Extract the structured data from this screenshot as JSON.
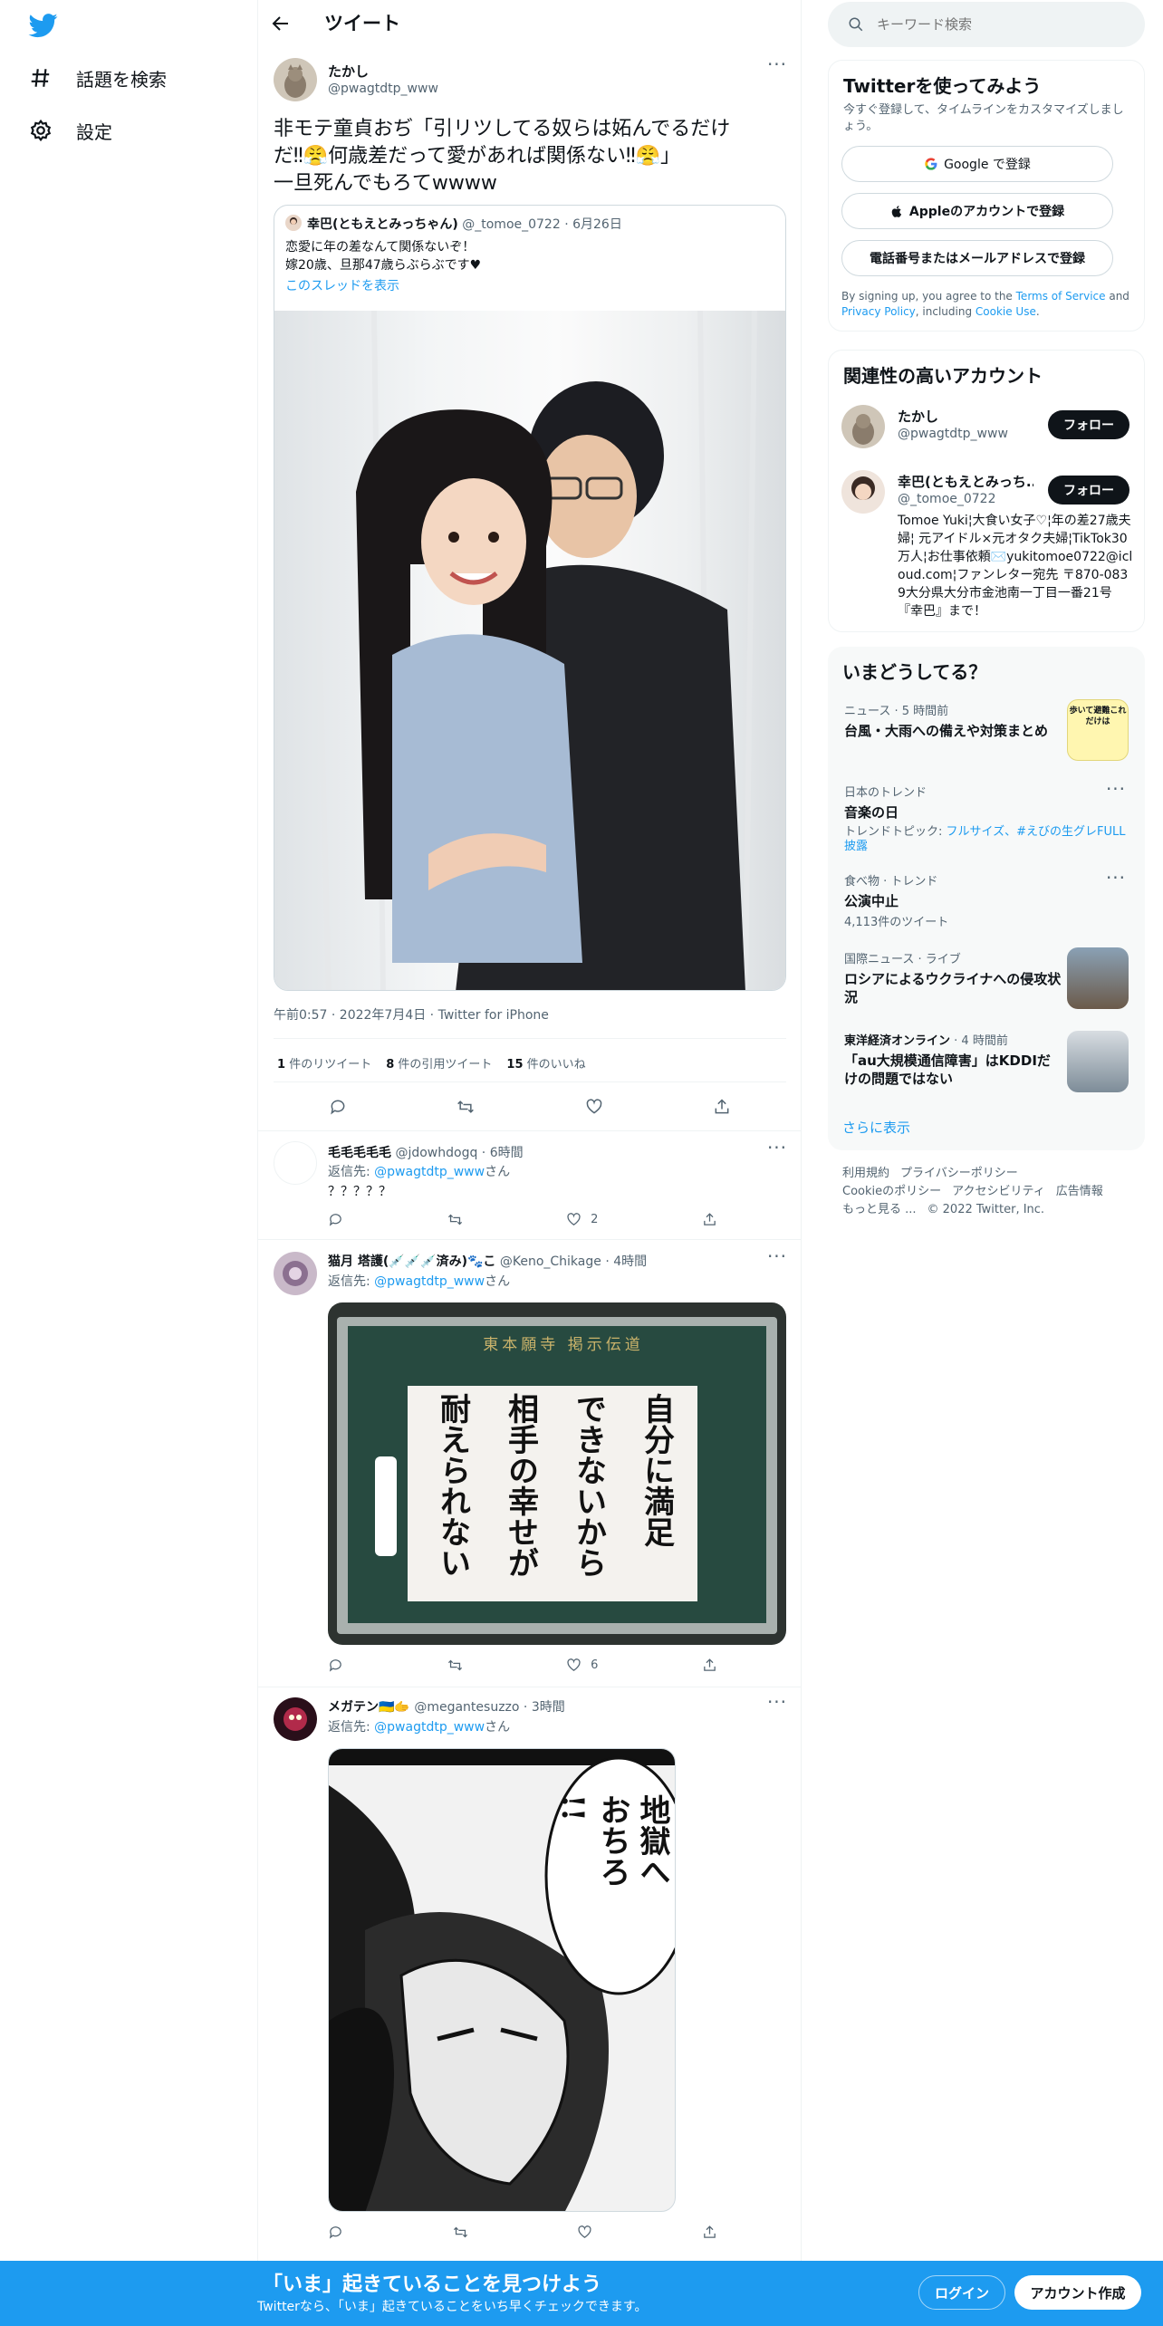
{
  "nav": {
    "explore": "話題を検索",
    "settings": "設定"
  },
  "header": {
    "title": "ツイート"
  },
  "tweet": {
    "name": "たかし",
    "handle": "@pwagtdtp_www",
    "text_line1": "非モテ童貞おぢ「引リツしてる奴らは妬んでるだけ",
    "text_line2": "だ‼😤何歳差だって愛があれば関係ない‼😤」",
    "text_line3": "一旦死んでもろてwwww",
    "quote": {
      "name": "幸巴(ともえとみっちゃん)",
      "handle": "@_tomoe_0722",
      "date": "6月26日",
      "line1": "恋愛に年の差なんて関係ないぞ！",
      "line2": "嫁20歳、旦那47歳らぶらぶです♥",
      "thread_link": "このスレッドを表示"
    },
    "timestamp": "午前0:57 · 2022年7月4日 · Twitter for iPhone",
    "retweets_count": "1",
    "retweets_label": "件のリツイート",
    "quotes_count": "8",
    "quotes_label": "件の引用ツイート",
    "likes_count": "15",
    "likes_label": "件のいいね"
  },
  "replies": [
    {
      "name": "毛毛毛毛毛",
      "handle": "@jdowhdogq",
      "time": "6時間",
      "reply_to_prefix": "返信先: ",
      "reply_to": "@pwagtdtp_www",
      "reply_to_suffix": "さん",
      "text": "？？？？？",
      "likes": "2"
    },
    {
      "name": "猫月 塔護(💉💉💉済み)🐾こ",
      "handle": "@Keno_Chikage",
      "time": "4時間",
      "reply_to_prefix": "返信先: ",
      "reply_to": "@pwagtdtp_www",
      "reply_to_suffix": "さん",
      "image_header": "東本願寺 掲示伝道",
      "image_text": [
        "自分に満足",
        "できないから",
        "相手の幸せが",
        "耐えられない"
      ],
      "likes": "6"
    },
    {
      "name": "メガテン🇺🇦🫱",
      "handle": "@megantesuzzo",
      "time": "3時間",
      "reply_to_prefix": "返信先: ",
      "reply_to": "@pwagtdtp_www",
      "reply_to_suffix": "さん",
      "image_text": [
        "地獄へ",
        "おちろ",
        "!!"
      ]
    }
  ],
  "search": {
    "placeholder": "キーワード検索"
  },
  "signup_panel": {
    "title": "Twitterを使ってみよう",
    "subtitle": "今すぐ登録して、タイムラインをカスタマイズしましょう。",
    "google": "Google で登録",
    "apple": "Appleのアカウントで登録",
    "phone": "電話番号またはメールアドレスで登録",
    "legal_1": "By signing up, you agree to the ",
    "tos": "Terms of Service",
    "legal_2": " and ",
    "privacy": "Privacy Policy",
    "legal_3": ", including ",
    "cookie": "Cookie Use",
    "legal_4": "."
  },
  "related": {
    "title": "関連性の高いアカウント",
    "follow": "フォロー",
    "accounts": [
      {
        "name": "たかし",
        "handle": "@pwagtdtp_www"
      },
      {
        "name": "幸巴(ともえとみっち...",
        "handle": "@_tomoe_0722",
        "bio": "Tomoe Yuki¦大食い女子♡¦年の差27歳夫婦¦ 元アイドル×元オタク夫婦¦TikTok30万人¦お仕事依頼✉️yukitomoe0722@icloud.com¦ファンレター宛先 〒870-0839大分県大分市金池南一丁目一番21号『幸巴』まで！"
      }
    ]
  },
  "trends": {
    "title": "いまどうしてる？",
    "items": [
      {
        "meta": "ニュース · 5 時間前",
        "title": "台風・大雨への備えや対策まとめ"
      },
      {
        "meta": "日本のトレンド",
        "title": "音楽の日",
        "topic_prefix": "トレンドトピック: ",
        "topic": "フルサイズ、#えびの生グレFULL披露"
      },
      {
        "meta": "食べ物 · トレンド",
        "title": "公演中止",
        "count": "4,113件のツイート"
      },
      {
        "meta": "国際ニュース · ライブ",
        "title": "ロシアによるウクライナへの侵攻状況"
      },
      {
        "meta_source": "東洋経済オンライン",
        "meta_time": " · 4 時間前",
        "title": "「au大規模通信障害」はKDDIだけの問題ではない"
      }
    ],
    "show_more": "さらに表示",
    "thumb1_text": "歩いて避難これだけは"
  },
  "footer": {
    "terms": "利用規約",
    "privacy": "プライバシーポリシー",
    "cookie": "Cookieのポリシー",
    "accessibility": "アクセシビリティ",
    "ads": "広告情報",
    "more": "もっと見る ...",
    "copyright": "© 2022 Twitter, Inc."
  },
  "bottom_bar": {
    "title": "「いま」起きていることを見つけよう",
    "subtitle": "Twitterなら、「いま」起きていることをいち早くチェックできます。",
    "login": "ログイン",
    "signup": "アカウント作成"
  },
  "colors": {
    "accent": "#1d9bf0",
    "text": "#0f1419",
    "muted": "#536471",
    "border": "#eff3f4"
  }
}
